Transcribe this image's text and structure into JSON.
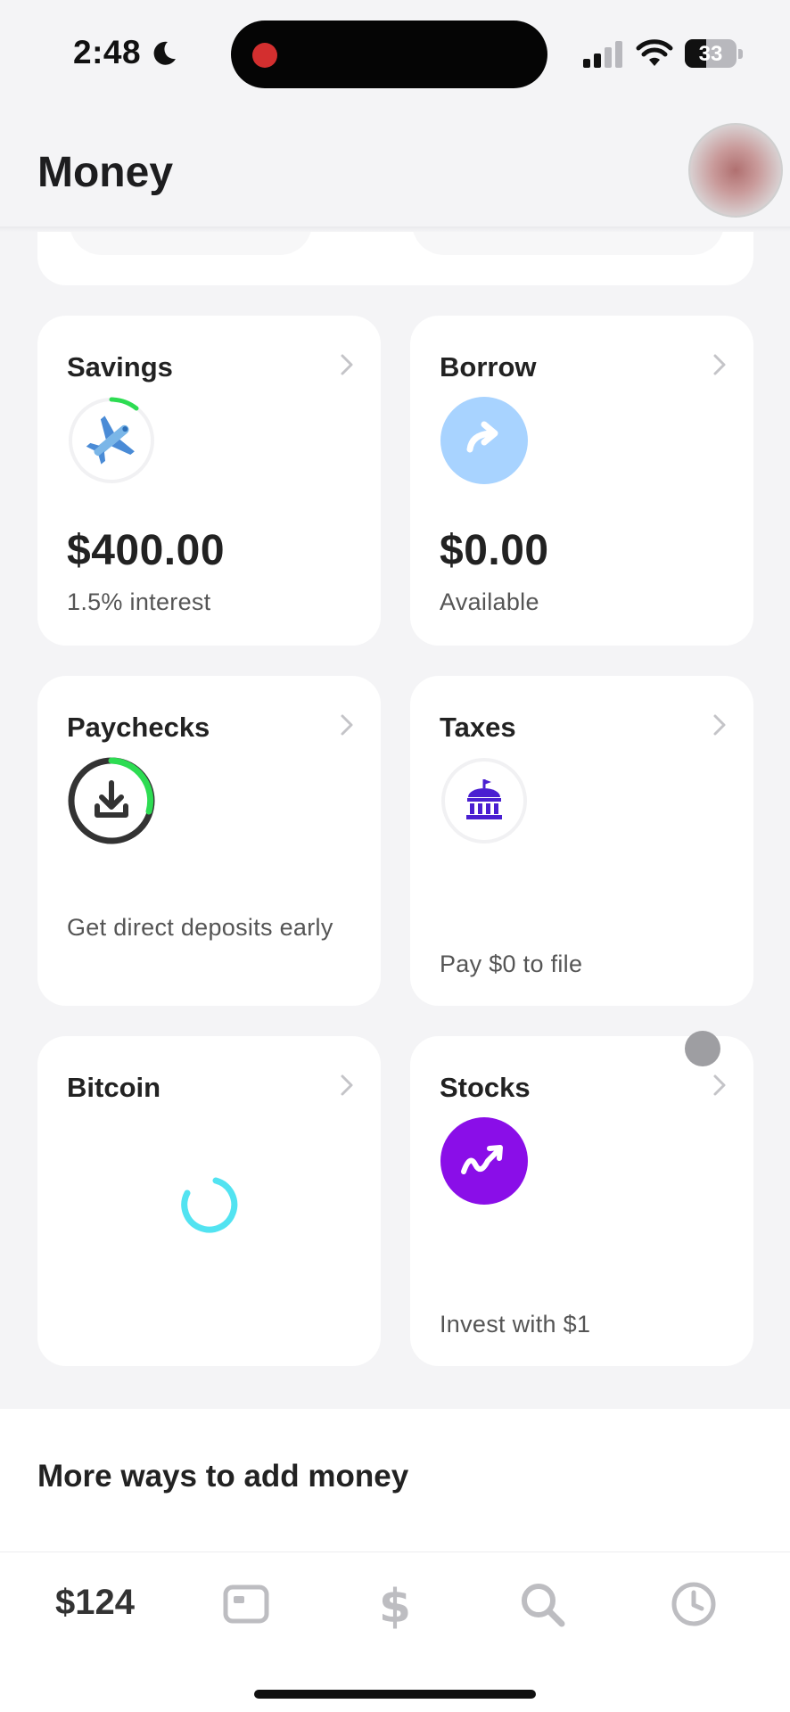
{
  "status_bar": {
    "time": "2:48",
    "battery": "33",
    "icons": [
      "moon-icon",
      "signal-icon",
      "wifi-icon",
      "battery-icon"
    ],
    "recording_color": "#d32f2f"
  },
  "header": {
    "title": "Money"
  },
  "tiles": {
    "savings": {
      "title": "Savings",
      "amount": "$400.00",
      "sub": "1.5% interest",
      "icon": "airplane-icon",
      "progress_color": "#2ddc52"
    },
    "borrow": {
      "title": "Borrow",
      "amount": "$0.00",
      "sub": "Available",
      "icon": "borrow-arrow-icon",
      "icon_bg": "#a8d3ff"
    },
    "paychecks": {
      "title": "Paychecks",
      "desc": "Get direct deposits early",
      "icon": "download-icon",
      "progress_color": "#2ddc52"
    },
    "taxes": {
      "title": "Taxes",
      "desc": "Pay $0 to file",
      "icon": "government-building-icon",
      "icon_color": "#4a1fd1"
    },
    "bitcoin": {
      "title": "Bitcoin",
      "icon": "loading-spinner-icon",
      "spinner_color": "#3fe0f0"
    },
    "stocks": {
      "title": "Stocks",
      "desc": "Invest with $1",
      "icon": "stocks-trend-icon",
      "icon_bg": "#8a0ee8"
    }
  },
  "more": {
    "title": "More ways to add money"
  },
  "tab_bar": {
    "balance": "$124",
    "tabs": [
      "card-icon",
      "dollar-icon",
      "search-icon",
      "activity-clock-icon"
    ]
  }
}
